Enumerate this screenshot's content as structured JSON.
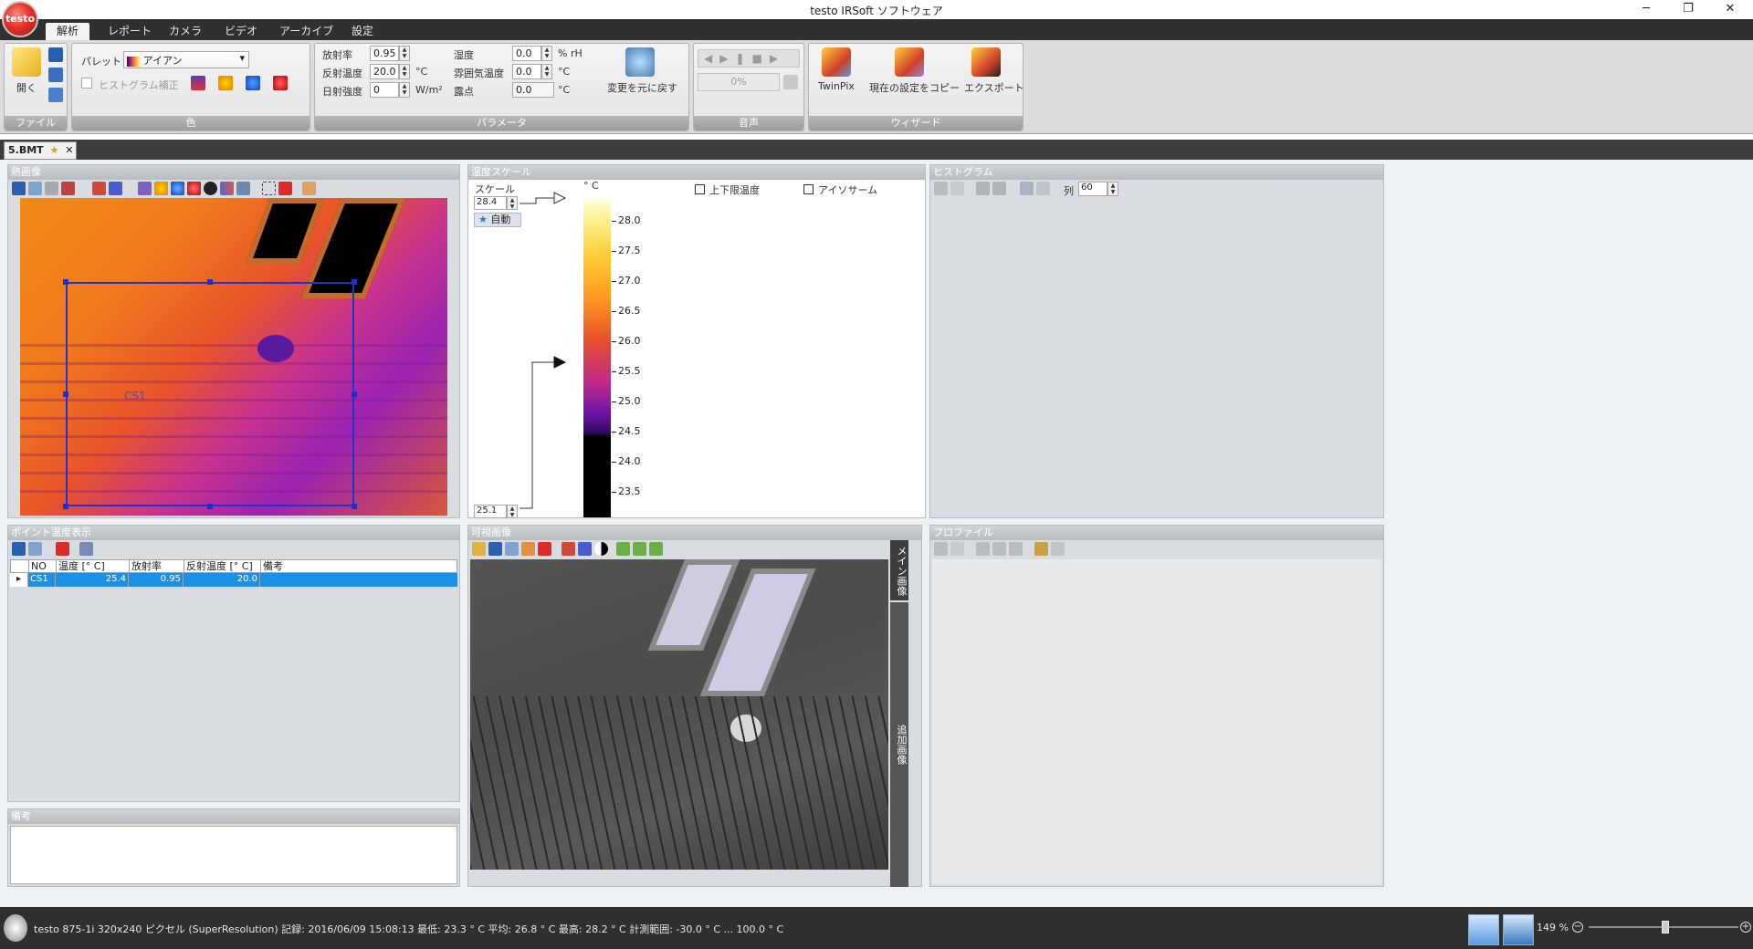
{
  "window": {
    "title": "testo IRSoft ソフトウェア",
    "logo_text": "testo"
  },
  "menu_tabs": [
    {
      "label": "解析",
      "active": true
    },
    {
      "label": "レポート"
    },
    {
      "label": "カメラ"
    },
    {
      "label": "ビデオ"
    },
    {
      "label": "アーカイブ"
    },
    {
      "label": "設定"
    }
  ],
  "ribbon": {
    "file": {
      "group_label": "ファイル",
      "open_label": "開く"
    },
    "color": {
      "group_label": "色",
      "palette_label": "パレット",
      "palette_value": "アイアン",
      "histogram_label": "ヒストグラム補正"
    },
    "params": {
      "group_label": "パラメータ",
      "emissivity_label": "放射率",
      "emissivity_value": "0.95",
      "reflected_label": "反射温度",
      "reflected_value": "20.0",
      "reflected_unit": "°C",
      "solar_label": "日射強度",
      "solar_value": "0",
      "solar_unit": "W/m²",
      "humidity_label": "湿度",
      "humidity_value": "0.0",
      "humidity_unit": "% rH",
      "ambient_label": "雰囲気温度",
      "ambient_value": "0.0",
      "ambient_unit": "°C",
      "dewpoint_label": "露点",
      "dewpoint_value": "0.0",
      "dewpoint_unit": "°C",
      "reset_label": "変更を元に戻す"
    },
    "audio": {
      "group_label": "音声",
      "progress_text": "0%"
    },
    "wizard": {
      "group_label": "ウィザード",
      "twinpix_label": "TwinPix",
      "copy_label": "現在の設定をコピー",
      "export_label": "エクスポート"
    }
  },
  "doc_tab": {
    "label": "5.BMT"
  },
  "thermal_panel": {
    "title": "熱画像",
    "roi_label": "CS1"
  },
  "scale_panel": {
    "title": "温度スケール",
    "scale_label": "スケール",
    "max_value": "28.4",
    "min_value": "25.1",
    "auto_label": "自動",
    "unit_label": "° C",
    "limit_label": "上下限温度",
    "isotherm_label": "アイソサーム",
    "ticks": [
      "28.0",
      "27.5",
      "27.0",
      "26.5",
      "26.0",
      "25.5",
      "25.0",
      "24.5",
      "24.0",
      "23.5"
    ]
  },
  "histogram_panel": {
    "title": "ヒストグラム",
    "columns_label": "列",
    "columns_value": "60"
  },
  "points_panel": {
    "title": "ポイント温度表示",
    "headers": [
      "NO",
      "温度 [° C]",
      "放射率",
      "反射温度 [° C]",
      "備考"
    ],
    "rows": [
      {
        "no": "CS1",
        "temp": "25.4",
        "emis": "0.95",
        "refl": "20.0",
        "note": ""
      }
    ]
  },
  "notes_panel": {
    "title": "備考"
  },
  "visual_panel": {
    "title": "可視画像",
    "tab_main": "メイン画像",
    "tab_extra": "追加画像"
  },
  "profile_panel": {
    "title": "プロファイル"
  },
  "status": {
    "text": "testo 875-1i 320x240 ピクセル (SuperResolution) 記録: 2016/06/09 15:08:13 最低: 23.3 ° C 平均: 26.8 ° C 最高: 28.2 ° C 計測範囲: -30.0 ° C ... 100.0 ° C",
    "zoom": "149 %"
  },
  "colors": {
    "accent": "#1c8fe6",
    "ribbon_label": "#a5a5a5",
    "status_bg": "#2f2f2f"
  }
}
